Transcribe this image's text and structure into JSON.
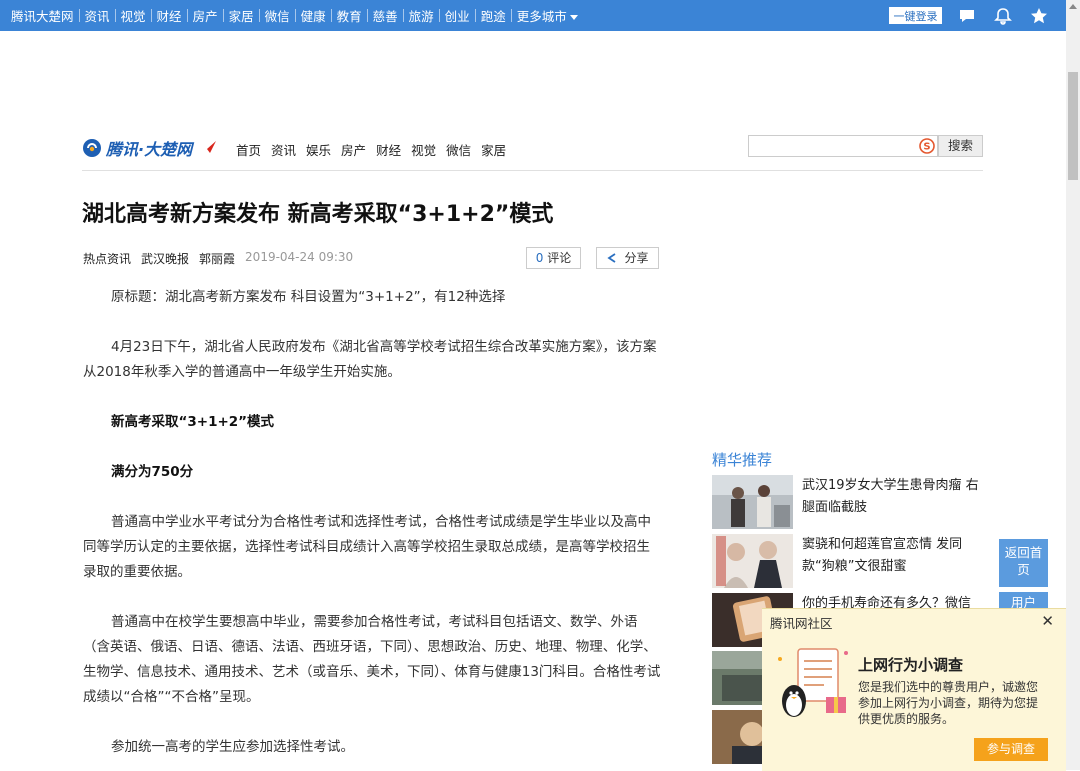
{
  "topbar": {
    "nav": [
      "腾讯大楚网",
      "资讯",
      "视觉",
      "财经",
      "房产",
      "家居",
      "微信",
      "健康",
      "教育",
      "慈善",
      "旅游",
      "创业",
      "跑途",
      "更多城市"
    ],
    "login_label": "一键登录"
  },
  "header": {
    "logo_text": "腾讯·大楚网",
    "nav": [
      "首页",
      "资讯",
      "娱乐",
      "房产",
      "财经",
      "视觉",
      "微信",
      "家居"
    ],
    "search_button": "搜索"
  },
  "article": {
    "title": "湖北高考新方案发布 新高考采取“3+1+2”模式",
    "category": "热点资讯",
    "source": "武汉晚报",
    "author": "郭丽霞",
    "datetime": "2019-04-24 09:30",
    "comment_count": "0",
    "comment_label": "评论",
    "share_label": "分享",
    "paragraphs": [
      {
        "text": "原标题：湖北高考新方案发布 科目设置为“3+1+2”，有12种选择",
        "bold": false
      },
      {
        "text": "4月23日下午，湖北省人民政府发布《湖北省高等学校考试招生综合改革实施方案》，该方案从2018年秋季入学的普通高中一年级学生开始实施。",
        "bold": false
      },
      {
        "text": "新高考采取“3+1+2”模式",
        "bold": true
      },
      {
        "text": "满分为750分",
        "bold": true
      },
      {
        "text": "普通高中学业水平考试分为合格性考试和选择性考试，合格性考试成绩是学生毕业以及高中同等学历认定的主要依据，选择性考试科目成绩计入高等学校招生录取总成绩，是高等学校招生录取的重要依据。",
        "bold": false
      },
      {
        "text": "普通高中在校学生要想高中毕业，需要参加合格性考试，考试科目包括语文、数学、外语（含英语、俄语、日语、德语、法语、西班牙语，下同）、思想政治、历史、地理、物理、化学、生物学、信息技术、通用技术、艺术（或音乐、美术，下同）、体育与健康13门科目。合格性考试成绩以“合格”“不合格”呈现。",
        "bold": false
      },
      {
        "text": "参加统一高考的学生应参加选择性考试。",
        "bold": false
      }
    ]
  },
  "recommend": {
    "title": "精华推荐",
    "items": [
      {
        "text": "武汉19岁女大学生患骨肉瘤 右腿面临截肢"
      },
      {
        "text": "窦骁和何超莲官宣恋情 发同款“狗粮”文很甜蜜"
      },
      {
        "text": "你的手机寿命还有多久？微信一"
      }
    ]
  },
  "float_buttons": {
    "back_home": "返回首页",
    "feedback": "用户"
  },
  "popup": {
    "community": "腾讯网社区",
    "heading": "上网行为小调查",
    "body": "您是我们选中的尊贵用户，诚邀您参加上网行为小调查，期待为您提供更优质的服务。",
    "button": "参与调查"
  }
}
